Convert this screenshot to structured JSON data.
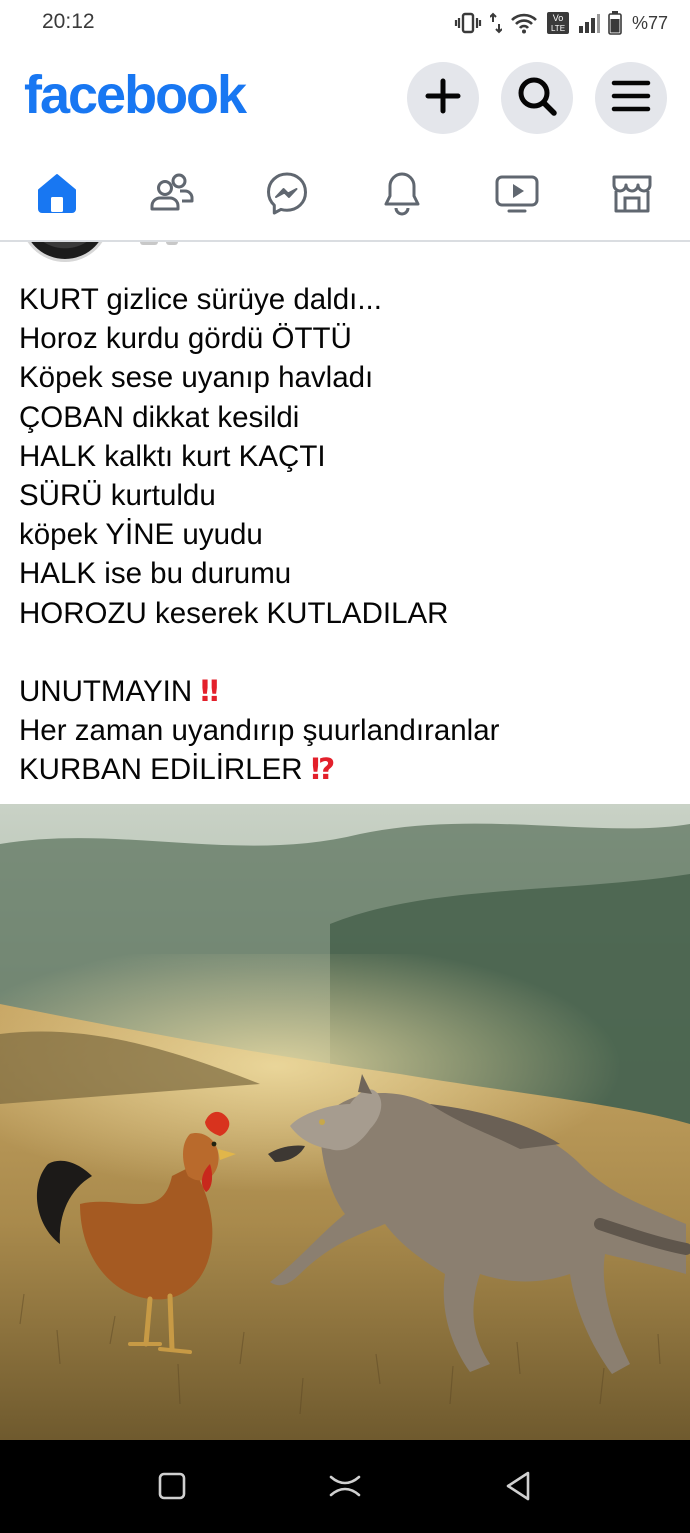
{
  "status_bar": {
    "time": "20:12",
    "battery": "%77",
    "network_badge_top": "Vo",
    "network_badge_bottom": "LTE"
  },
  "header": {
    "brand": "facebook",
    "brand_color": "#1877f2",
    "buttons": [
      "plus-icon",
      "search-icon",
      "menu-icon"
    ]
  },
  "nav_tabs": [
    {
      "name": "home",
      "icon": "home-icon",
      "active": true
    },
    {
      "name": "friends",
      "icon": "friends-icon",
      "active": false
    },
    {
      "name": "messenger",
      "icon": "messenger-icon",
      "active": false
    },
    {
      "name": "notifications",
      "icon": "bell-icon",
      "active": false
    },
    {
      "name": "watch",
      "icon": "video-icon",
      "active": false
    },
    {
      "name": "marketplace",
      "icon": "store-icon",
      "active": false
    }
  ],
  "post": {
    "lines": [
      "KURT gizlice sürüye daldı...",
      "Horoz kurdu gördü ÖTTÜ",
      "Köpek sese uyanıp havladı",
      "ÇOBAN dikkat kesildi",
      "HALK kalktı kurt KAÇTI",
      "SÜRÜ kurtuldu",
      "köpek YİNE uyudu",
      "HALK ise bu durumu",
      "HOROZU keserek KUTLADILAR"
    ],
    "closing_line_1": "UNUTMAYIN",
    "closing_line_1_emoji": "‼",
    "closing_line_2": "Her zaman uyandırıp şuurlandıranlar",
    "closing_line_3": "KURBAN EDİLİRLER",
    "closing_line_3_emoji": "⁉"
  },
  "system_nav": [
    "recents-button",
    "home-button",
    "back-button"
  ]
}
